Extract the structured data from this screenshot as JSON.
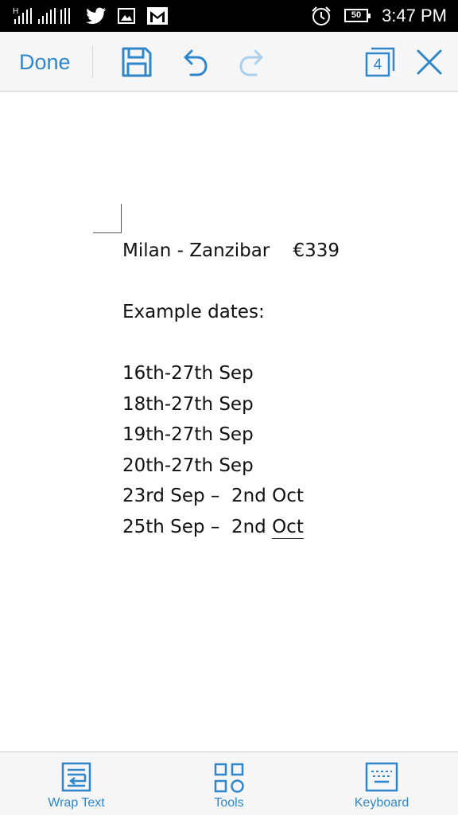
{
  "status_bar": {
    "time": "3:47 PM",
    "battery": "50",
    "signal_label": "H",
    "icons": [
      "signal-icon",
      "twitter-icon",
      "image-icon",
      "gmail-icon",
      "alarm-icon",
      "battery-icon"
    ]
  },
  "toolbar": {
    "done_label": "Done",
    "tab_count": "4",
    "icons": [
      "save-icon",
      "undo-icon",
      "redo-icon",
      "tabs-icon",
      "close-icon"
    ],
    "accent_color": "#2f86c9",
    "disabled_color": "#a9d0ee"
  },
  "document": {
    "lines": [
      "Milan - Zanzibar    €339",
      "Example dates:",
      "16th-27th Sep",
      "18th-27th Sep",
      "19th-27th Sep",
      "20th-27th Sep",
      "23rd Sep –  2nd Oct"
    ],
    "last_line_prefix": "25th Sep –  2nd ",
    "last_line_word": "Oct"
  },
  "bottom_bar": {
    "wrap_text_label": "Wrap Text",
    "tools_label": "Tools",
    "keyboard_label": "Keyboard"
  }
}
